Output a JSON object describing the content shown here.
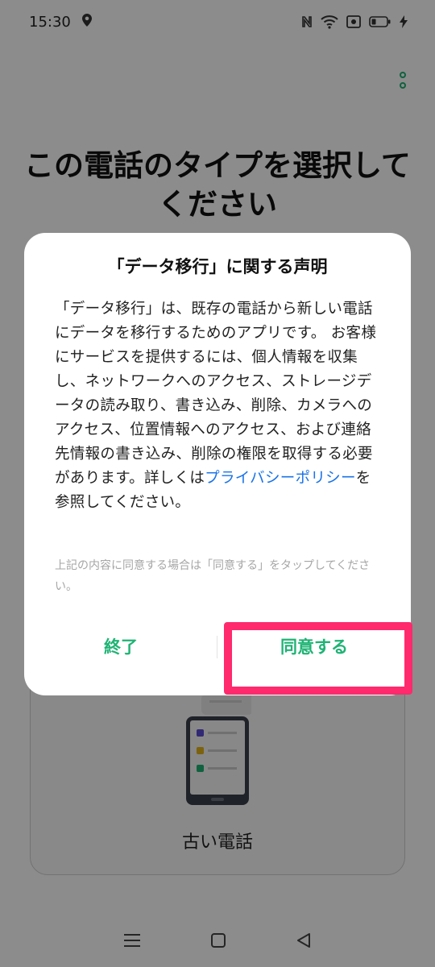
{
  "status_bar": {
    "time": "15:30",
    "icons": [
      "location-icon",
      "nfc-icon",
      "wifi-icon",
      "screen-record-icon",
      "battery-icon",
      "charging-icon"
    ]
  },
  "page": {
    "title_line1": "この電話のタイプを選択して",
    "title_line2": "ください",
    "option_label": "古い電話"
  },
  "dialog": {
    "title": "「データ移行」に関する声明",
    "body_before_link": "「データ移行」は、既存の電話から新しい電話にデータを移行するためのアプリです。 お客様にサービスを提供するには、個人情報を収集し、ネットワークへのアクセス、ストレージデータの読み取り、書き込み、削除、カメラへのアクセス、位置情報へのアクセス、および連絡先情報の書き込み、削除の権限を取得する必要があります。詳しくは",
    "link_text": "プライバシーポリシー",
    "body_after_link": "を参照してください。",
    "hint": "上記の内容に同意する場合は「同意する」をタップしてください。",
    "cancel_label": "終了",
    "agree_label": "同意する"
  },
  "colors": {
    "accent": "#1eb374",
    "link": "#1a73e8",
    "highlight": "#ff2a6d"
  }
}
